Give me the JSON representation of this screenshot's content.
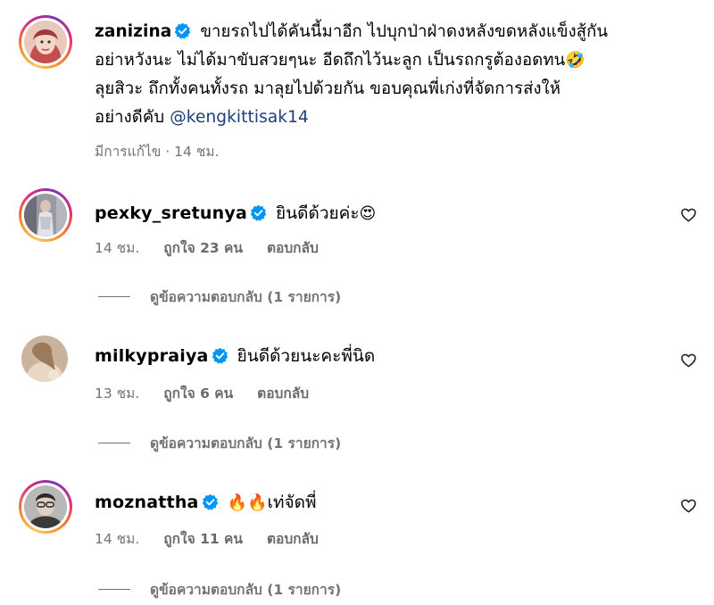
{
  "post": {
    "username": "zanizina",
    "caption_line1": "ขายรถไปได้คันนี้มาอีก ไปบุกป่าฝ่าดงหลังขดหลังแข็งสู้กัน",
    "caption_line2": "อย่าหวังนะ ไม่ได้มาขับสวยๆนะ อีดถึกไว้นะลูก เป็นรถกรูต้องอดทน",
    "caption_line2_emoji": "🤣",
    "caption_line3": "ลุยสิวะ ถึกทั้งคนทั้งรถ มาลุยไปด้วยกัน ขอบคุณพี่เก่งที่จัดการส่งให้",
    "caption_line4": "อย่างดีคับ",
    "mention": "@kengkittisak14",
    "meta": "มีการแก้ไข · 14 ชม."
  },
  "comments": [
    {
      "username": "pexky_sretunya",
      "text": "ยินดีด้วยค่ะ",
      "emoji": "😍",
      "time": "14 ชม.",
      "likes": "ถูกใจ 23 คน",
      "reply": "ตอบกลับ",
      "view_replies": "ดูข้อความตอบกลับ (1 รายการ)"
    },
    {
      "username": "milkypraiya",
      "text": "ยินดีด้วยนะคะพี่นิด",
      "emoji": "",
      "time": "13 ชม.",
      "likes": "ถูกใจ 6 คน",
      "reply": "ตอบกลับ",
      "view_replies": "ดูข้อความตอบกลับ (1 รายการ)"
    },
    {
      "username": "moznattha",
      "text": "เท่จัดพี่",
      "emoji": "🔥🔥",
      "time": "14 ชม.",
      "likes": "ถูกใจ 11 คน",
      "reply": "ตอบกลับ",
      "view_replies": "ดูข้อความตอบกลับ (1 รายการ)"
    }
  ],
  "colors": {
    "verified": "#0095f6",
    "mention": "#1f3d7a",
    "secondary_text": "#737373"
  }
}
